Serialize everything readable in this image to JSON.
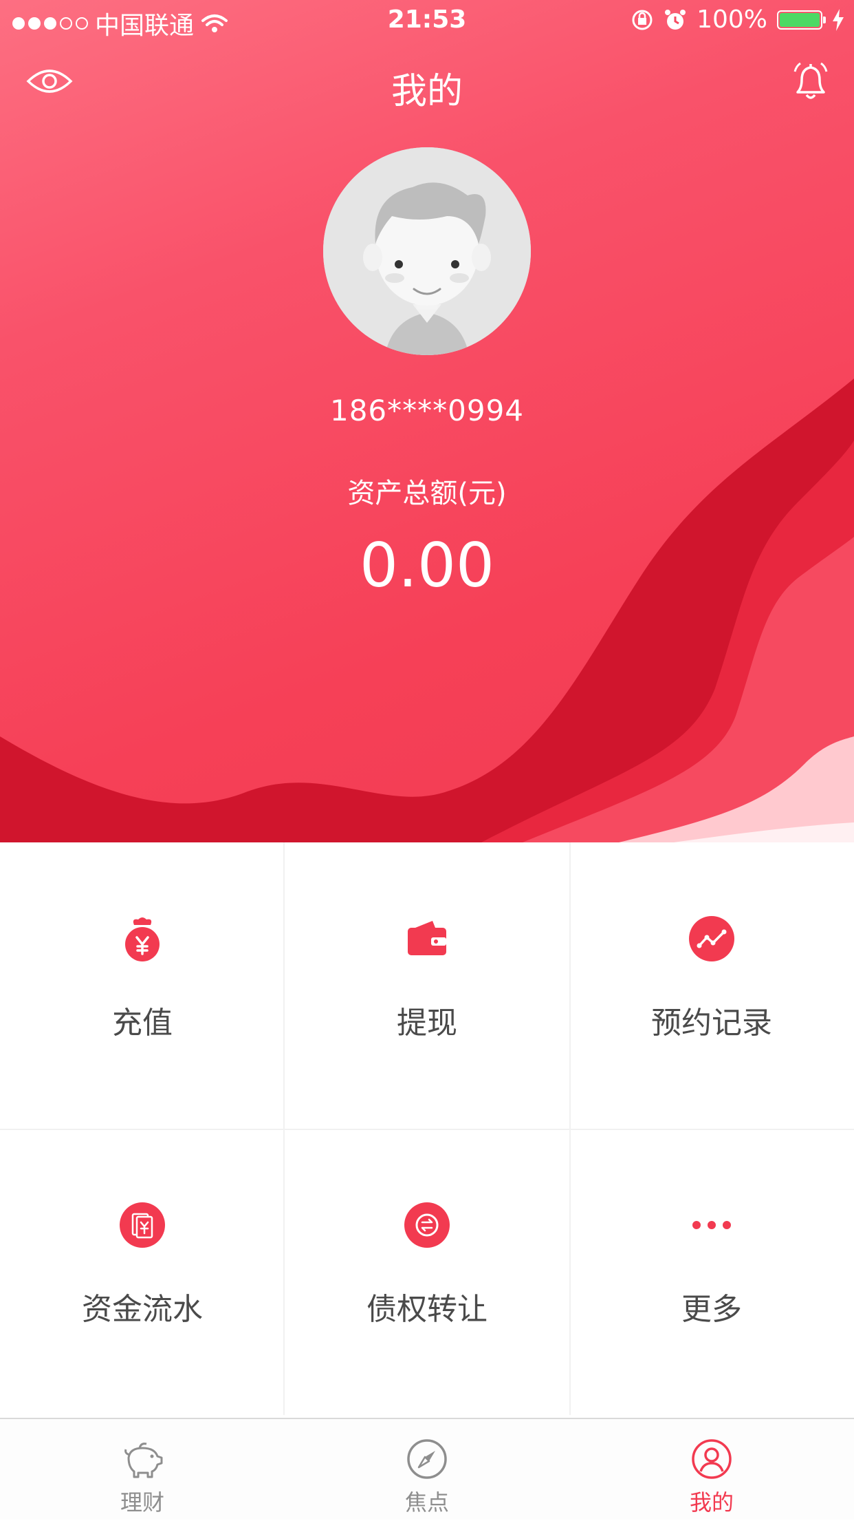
{
  "status_bar": {
    "carrier": "中国联通",
    "time": "21:53",
    "battery": "100%"
  },
  "nav": {
    "title": "我的"
  },
  "profile": {
    "phone": "186****0994",
    "asset_label": "资产总额(元)",
    "asset_value": "0.00"
  },
  "menu": [
    {
      "label": "充值",
      "icon": "money-bag-icon"
    },
    {
      "label": "提现",
      "icon": "wallet-icon"
    },
    {
      "label": "预约记录",
      "icon": "trend-chart-icon"
    },
    {
      "label": "资金流水",
      "icon": "cash-flow-icon"
    },
    {
      "label": "债权转让",
      "icon": "transfer-icon"
    },
    {
      "label": "更多",
      "icon": "more-dots-icon"
    }
  ],
  "tabbar": [
    {
      "label": "理财",
      "icon": "piggy-bank-icon"
    },
    {
      "label": "焦点",
      "icon": "compass-icon"
    },
    {
      "label": "我的",
      "icon": "user-icon"
    }
  ],
  "colors": {
    "brand_red": "#f23a50",
    "hero_top": "#fd6f82",
    "hero_bottom": "#f03b52",
    "battery_green": "#4cd964"
  }
}
